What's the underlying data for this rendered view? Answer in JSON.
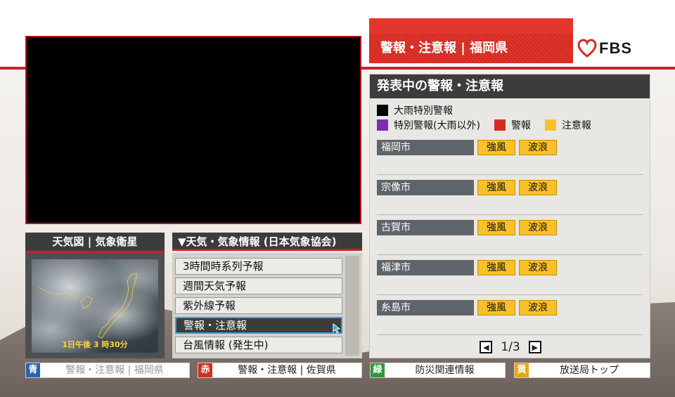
{
  "header": {
    "title": "警報・注意報 | 福岡県",
    "logo_text": "FBS"
  },
  "warnings_panel": {
    "title": "発表中の警報・注意報",
    "legend": {
      "heavy_rain_special": "大雨特別警報",
      "special_other": "特別警報(大雨以外)",
      "warning": "警報",
      "advisory": "注意報"
    },
    "colors": {
      "heavy_rain_special": "#000000",
      "special_other": "#7b2fb0",
      "warning": "#d22e22",
      "advisory": "#f9c02a"
    },
    "cities": [
      {
        "name": "福岡市",
        "alerts": [
          "強風",
          "波浪"
        ]
      },
      {
        "name": "宗像市",
        "alerts": [
          "強風",
          "波浪"
        ]
      },
      {
        "name": "古賀市",
        "alerts": [
          "強風",
          "波浪"
        ]
      },
      {
        "name": "福津市",
        "alerts": [
          "強風",
          "波浪"
        ]
      },
      {
        "name": "糸島市",
        "alerts": [
          "強風",
          "波浪"
        ]
      }
    ],
    "pager": {
      "text": "1/3"
    }
  },
  "weather_map": {
    "title": "天気図 | 気象衛星",
    "timestamp": "1日午後 3 時30分"
  },
  "weather_menu": {
    "title": "▼天気・気象情報 (日本気象協会)",
    "items": [
      "3時間時系列予報",
      "週間天気予報",
      "紫外線予報",
      "警報・注意報",
      "台風情報 (発生中)"
    ],
    "selected_index": 3
  },
  "bottom_nav": [
    {
      "key": "青",
      "color": "#2a63b5",
      "label": "警報・注意報 | 福岡県",
      "dim": true
    },
    {
      "key": "赤",
      "color": "#d22e22",
      "label": "警報・注意報 | 佐賀県",
      "dim": false
    },
    {
      "key": "緑",
      "color": "#2f9a3b",
      "label": "防災関連情報",
      "dim": false
    },
    {
      "key": "黄",
      "color": "#e8a618",
      "label": "放送局トップ",
      "dim": false
    }
  ]
}
